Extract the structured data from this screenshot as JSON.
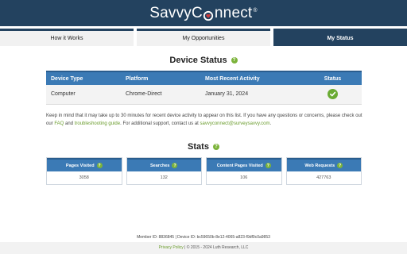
{
  "brand": {
    "name_before": "Savvy",
    "name_c": "C",
    "name_after": "nnect",
    "reg": "®"
  },
  "tabs": [
    {
      "label": "How it Works"
    },
    {
      "label": "My Opportunities"
    },
    {
      "label": "My Status"
    }
  ],
  "device_status": {
    "title": "Device Status",
    "help": "?",
    "columns": [
      "Device Type",
      "Platform",
      "Most Recent Activity",
      "Status"
    ],
    "rows": [
      {
        "device_type": "Computer",
        "platform": "Chrome-Direct",
        "activity": "January 31, 2024",
        "status_icon": "check-icon"
      }
    ]
  },
  "note": {
    "text1": "Keep in mind that it may take up to 30 minutes for recent device activity to appear on this list. If you have any questions or concerns, please check out our ",
    "faq": "FAQ",
    "text2": " and ",
    "guide": "troubleshooting guide",
    "text3": ". For additional support, contact us at ",
    "email": "savvyconnect@surveysavvy.com",
    "text4": "."
  },
  "stats": {
    "title": "Stats",
    "help": "?",
    "items": [
      {
        "label": "Pages Visited",
        "value": "3058"
      },
      {
        "label": "Searches",
        "value": "132"
      },
      {
        "label": "Content Pages Visited",
        "value": "106"
      },
      {
        "label": "Web Requests",
        "value": "427763"
      }
    ]
  },
  "footer": {
    "member_id": "Member ID: 8836845 | Device ID: bc59650b-8e12-4065-a823-f9df9c0a9853",
    "privacy": "Privacy Policy",
    "copyright": " | © 2015 - 2024 Luth Research, LLC"
  },
  "colors": {
    "header": "#23425f",
    "table_head": "#3b7ab5",
    "accent_green": "#7cb33a"
  }
}
